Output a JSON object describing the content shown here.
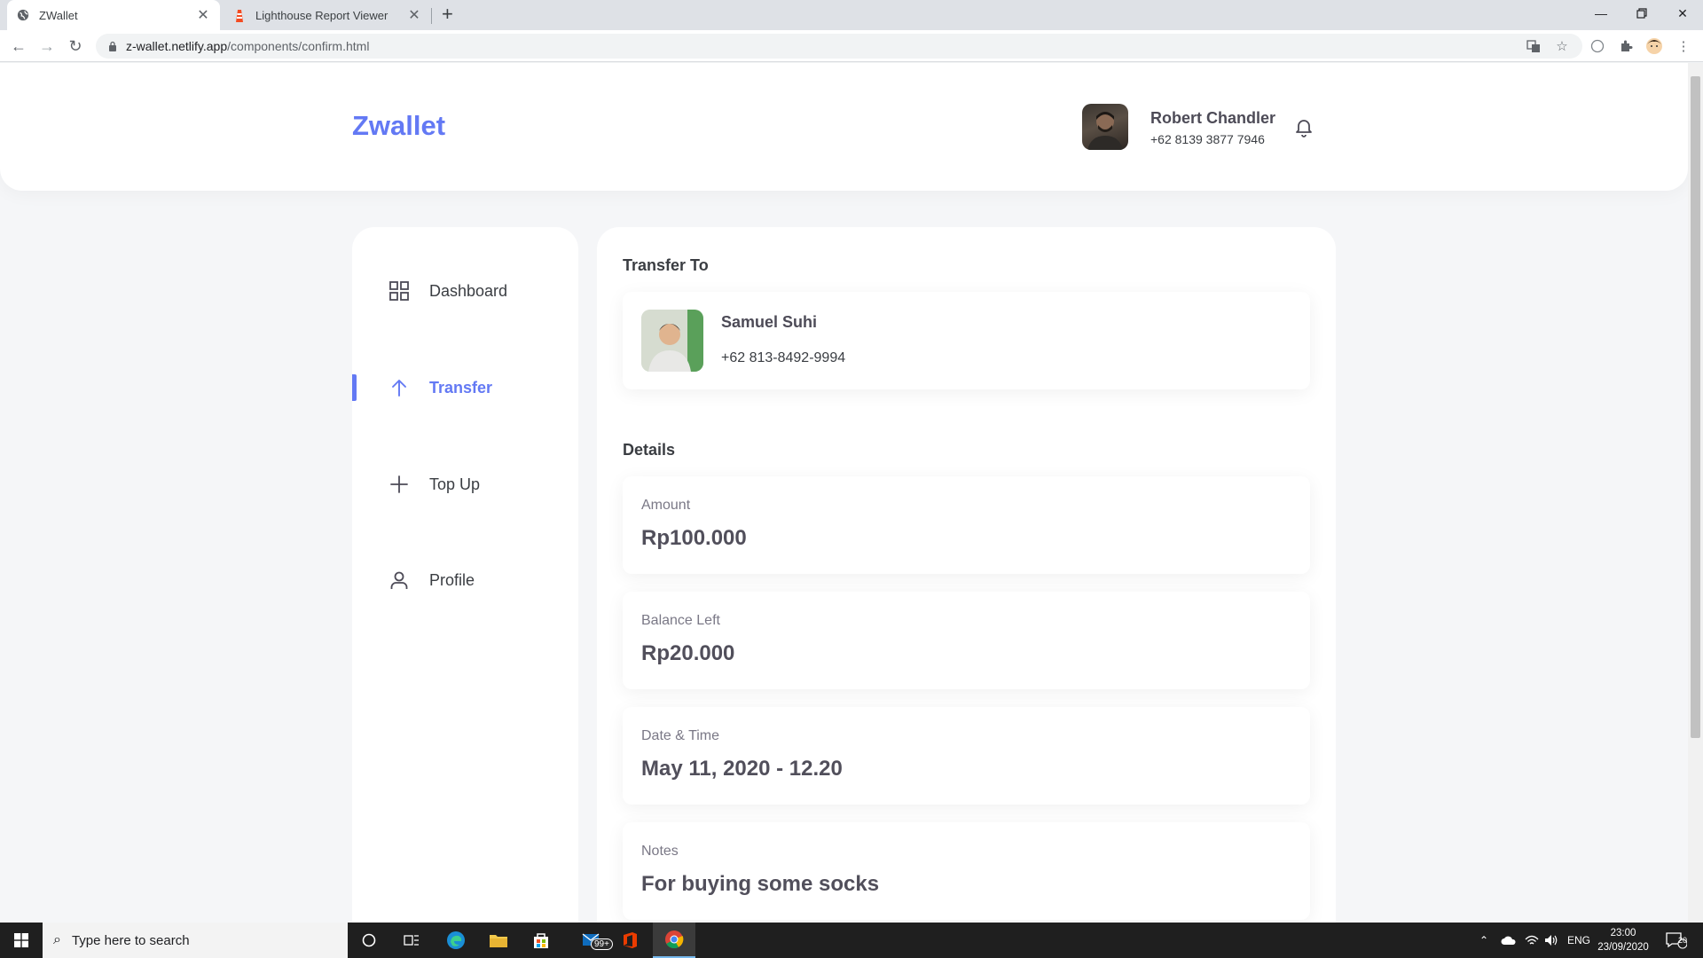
{
  "browser": {
    "tabs": [
      {
        "title": "ZWallet",
        "active": true
      },
      {
        "title": "Lighthouse Report Viewer",
        "active": false
      }
    ],
    "url_host": "z-wallet.netlify.app",
    "url_path": "/components/confirm.html"
  },
  "header": {
    "brand": "Zwallet",
    "user_name": "Robert Chandler",
    "user_phone": "+62 8139 3877 7946"
  },
  "sidebar": {
    "items": [
      {
        "label": "Dashboard",
        "icon": "grid-icon",
        "active": false
      },
      {
        "label": "Transfer",
        "icon": "arrow-up-icon",
        "active": true
      },
      {
        "label": "Top Up",
        "icon": "plus-icon",
        "active": false
      },
      {
        "label": "Profile",
        "icon": "user-icon",
        "active": false
      }
    ]
  },
  "transfer": {
    "title": "Transfer To",
    "receiver_name": "Samuel Suhi",
    "receiver_phone": "+62 813-8492-9994"
  },
  "details": {
    "title": "Details",
    "items": [
      {
        "label": "Amount",
        "value": "Rp100.000"
      },
      {
        "label": "Balance Left",
        "value": "Rp20.000"
      },
      {
        "label": "Date & Time",
        "value": "May 11, 2020 - 12.20"
      },
      {
        "label": "Notes",
        "value": "For buying some socks"
      }
    ]
  },
  "taskbar": {
    "search_placeholder": "Type here to search",
    "mail_badge": "99+",
    "language": "ENG",
    "time": "23:00",
    "date": "23/09/2020",
    "notif_count": "20"
  },
  "colors": {
    "accent": "#6379f4",
    "page_bg": "#f5f6f8"
  }
}
